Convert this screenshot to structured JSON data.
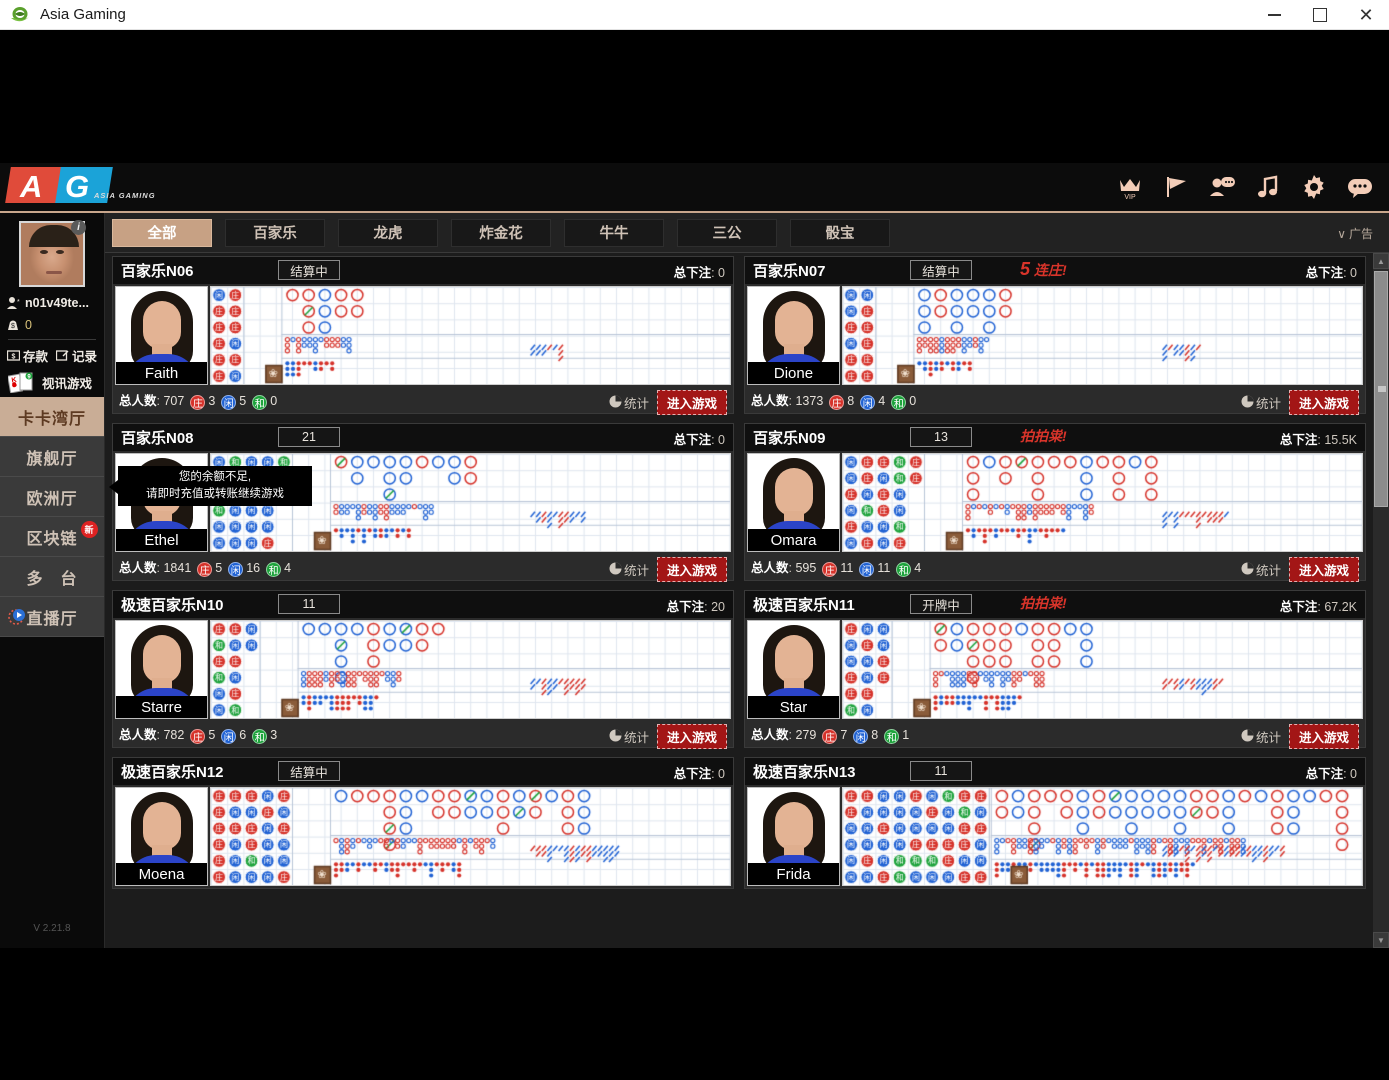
{
  "window": {
    "title": "Asia Gaming",
    "icon": "internet-explorer-icon",
    "minimize": "—",
    "maximize": "□",
    "close": "✕"
  },
  "header": {
    "logo_a": "A",
    "logo_g": "G",
    "logo_sub": "ASIA GAMING",
    "icons": [
      {
        "name": "vip-crown-icon",
        "label": "VIP"
      },
      {
        "name": "flag-icon",
        "label": ""
      },
      {
        "name": "person-chat-icon",
        "label": ""
      },
      {
        "name": "music-note-icon",
        "label": ""
      },
      {
        "name": "gear-icon",
        "label": ""
      },
      {
        "name": "chat-bubble-icon",
        "label": ""
      }
    ]
  },
  "tabs": [
    {
      "label": "全部",
      "active": true
    },
    {
      "label": "百家乐",
      "active": false
    },
    {
      "label": "龙虎",
      "active": false
    },
    {
      "label": "炸金花",
      "active": false
    },
    {
      "label": "牛牛",
      "active": false
    },
    {
      "label": "三公",
      "active": false
    },
    {
      "label": "骰宝",
      "active": false
    }
  ],
  "ad_toggle": {
    "chevron": "∨",
    "label": "广告"
  },
  "sidebar": {
    "info_badge": "i",
    "username": "n01v49te...",
    "balance": "0",
    "deposit_label": "存款",
    "record_label": "记录",
    "video_game_label": "视讯游戏",
    "card_k": "K",
    "card_9": "9",
    "halls": [
      {
        "label": "卡卡湾厅",
        "active": true,
        "badge": "",
        "icon": ""
      },
      {
        "label": "旗舰厅",
        "active": false,
        "badge": "",
        "icon": ""
      },
      {
        "label": "欧洲厅",
        "active": false,
        "badge": "",
        "icon": ""
      },
      {
        "label": "区块链",
        "active": false,
        "badge": "新",
        "icon": ""
      },
      {
        "label": "多　台",
        "active": false,
        "badge": "",
        "icon": ""
      },
      {
        "label": "直播厅",
        "active": false,
        "badge": "",
        "icon": "live-play-icon"
      }
    ],
    "version": "V 2.21.8"
  },
  "tooltip": {
    "line1": "您的余额不足,",
    "line2": "请即时充值或转账继续游戏"
  },
  "labels": {
    "total_bet": "总下注",
    "total_people": "总人数",
    "banker": "庄",
    "player": "闲",
    "tie": "和",
    "stats": "统计",
    "enter": "进入游戏"
  },
  "colors": {
    "banker": "#d6322a",
    "player": "#2062d4",
    "tie": "#1ea33c",
    "accent": "#c7a184",
    "enter_btn": "#a31616",
    "streak": "#d8342a"
  },
  "tables": [
    {
      "id": "table-n06",
      "title": "百家乐N06",
      "status": "结算中",
      "status_type": "text",
      "streak": "",
      "streak_num": "",
      "total_bet": "0",
      "dealer": "Faith",
      "total_people": "707",
      "banker_count": "3",
      "player_count": "5",
      "tie_count": "0",
      "bead": [
        [
          "P",
          "B"
        ],
        [
          "B",
          "B"
        ],
        [
          "B",
          "B"
        ],
        [
          "B",
          "P"
        ],
        [
          "B",
          "B"
        ],
        [
          "B",
          "P"
        ]
      ],
      "big_road": [
        [
          1,
          0,
          0,
          0,
          0
        ],
        [
          1,
          0
        ],
        [
          1
        ]
      ],
      "big_cols": 5
    },
    {
      "id": "table-n07",
      "title": "百家乐N07",
      "status": "结算中",
      "status_type": "text",
      "streak": "连庄!",
      "streak_num": "5",
      "total_bet": "0",
      "dealer": "Dione",
      "total_people": "1373",
      "banker_count": "8",
      "player_count": "4",
      "tie_count": "0",
      "bead": [
        [
          "P",
          "P"
        ],
        [
          "P",
          "B"
        ],
        [
          "B",
          "B"
        ],
        [
          "P",
          "B"
        ],
        [
          "B",
          "B"
        ],
        [
          "B",
          "B"
        ]
      ],
      "big_cols": 6
    },
    {
      "id": "table-n08",
      "title": "百家乐N08",
      "status": "21",
      "status_type": "countdown",
      "streak": "",
      "streak_num": "",
      "total_bet": "0",
      "dealer": "Ethel",
      "total_people": "1841",
      "banker_count": "5",
      "player_count": "16",
      "tie_count": "4",
      "bead": [
        [
          "P",
          "T",
          "P",
          "P",
          "T"
        ],
        [
          "P",
          "B",
          "P",
          "B"
        ],
        [
          "B",
          "T",
          "P",
          "B"
        ],
        [
          "T",
          "P",
          "P",
          "P"
        ],
        [
          "P",
          "P",
          "P",
          "P"
        ],
        [
          "P",
          "P",
          "P",
          "B"
        ]
      ],
      "big_cols": 9
    },
    {
      "id": "table-n09",
      "title": "百家乐N09",
      "status": "13",
      "status_type": "countdown",
      "streak": "拍拍粜!",
      "streak_num": "",
      "total_bet": "15.5K",
      "dealer": "Omara",
      "total_people": "595",
      "banker_count": "11",
      "player_count": "11",
      "tie_count": "4",
      "bead": [
        [
          "P",
          "B",
          "B",
          "T",
          "B"
        ],
        [
          "P",
          "B",
          "P",
          "T",
          "B"
        ],
        [
          "B",
          "P",
          "B",
          "P"
        ],
        [
          "P",
          "T",
          "B",
          "P"
        ],
        [
          "B",
          "P",
          "P",
          "T"
        ],
        [
          "P",
          "B",
          "P",
          "B"
        ]
      ],
      "big_cols": 12
    },
    {
      "id": "table-n10",
      "title": "极速百家乐N10",
      "status": "11",
      "status_type": "countdown",
      "streak": "",
      "streak_num": "",
      "total_bet": "20",
      "dealer": "Starre",
      "total_people": "782",
      "banker_count": "5",
      "player_count": "6",
      "tie_count": "3",
      "bead": [
        [
          "B",
          "B",
          "P"
        ],
        [
          "T",
          "P",
          "P"
        ],
        [
          "B",
          "B"
        ],
        [
          "T",
          "P"
        ],
        [
          "P",
          "B"
        ],
        [
          "P",
          "T"
        ]
      ],
      "big_cols": 9
    },
    {
      "id": "table-n11",
      "title": "极速百家乐N11",
      "status": "开牌中",
      "status_type": "text",
      "streak": "拍拍粜!",
      "streak_num": "",
      "total_bet": "67.2K",
      "dealer": "Star",
      "total_people": "279",
      "banker_count": "7",
      "player_count": "8",
      "tie_count": "1",
      "bead": [
        [
          "B",
          "P",
          "P"
        ],
        [
          "P",
          "B",
          "P"
        ],
        [
          "P",
          "P",
          "B"
        ],
        [
          "B",
          "P",
          "B"
        ],
        [
          "B",
          "B"
        ],
        [
          "T",
          "P"
        ]
      ],
      "big_cols": 10
    },
    {
      "id": "table-n12",
      "title": "极速百家乐N12",
      "status": "结算中",
      "status_type": "text",
      "streak": "",
      "streak_num": "",
      "total_bet": "0",
      "dealer": "Moena",
      "total_people": "",
      "banker_count": "",
      "player_count": "",
      "tie_count": "",
      "bead": [
        [
          "B",
          "B",
          "B",
          "P",
          "B"
        ],
        [
          "B",
          "P",
          "P",
          "B",
          "P"
        ],
        [
          "B",
          "B",
          "B",
          "P",
          "B"
        ],
        [
          "B",
          "P",
          "B",
          "P",
          "P"
        ],
        [
          "B",
          "P",
          "T",
          "P",
          "P"
        ],
        [
          "B",
          "P",
          "P",
          "P",
          "B"
        ]
      ],
      "big_cols": 16,
      "no_footer": true
    },
    {
      "id": "table-n13",
      "title": "极速百家乐N13",
      "status": "11",
      "status_type": "countdown",
      "streak": "",
      "streak_num": "",
      "total_bet": "0",
      "dealer": "Frida",
      "total_people": "",
      "banker_count": "",
      "player_count": "",
      "tie_count": "",
      "bead": [
        [
          "B",
          "B",
          "P",
          "P",
          "B",
          "P",
          "T",
          "B",
          "B"
        ],
        [
          "B",
          "P",
          "P",
          "P",
          "P",
          "B",
          "P",
          "T",
          "P"
        ],
        [
          "P",
          "P",
          "B",
          "P",
          "P",
          "P",
          "P",
          "B",
          "B"
        ],
        [
          "P",
          "P",
          "P",
          "P",
          "B",
          "B",
          "B",
          "B",
          "P"
        ],
        [
          "P",
          "B",
          "P",
          "T",
          "T",
          "T",
          "B",
          "P",
          "P"
        ],
        [
          "P",
          "P",
          "B",
          "T",
          "P",
          "P",
          "P",
          "B",
          "B"
        ]
      ],
      "big_cols": 26,
      "no_footer": true
    }
  ]
}
